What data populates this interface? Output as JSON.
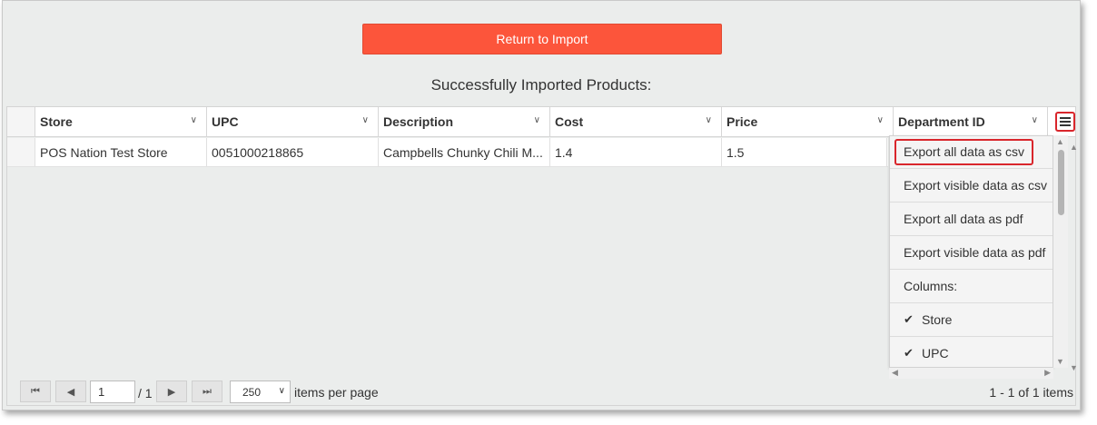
{
  "return_button": {
    "label": "Return to Import"
  },
  "page_title": "Successfully Imported Products:",
  "grid": {
    "columns": [
      {
        "label": "Store"
      },
      {
        "label": "UPC"
      },
      {
        "label": "Description"
      },
      {
        "label": "Cost"
      },
      {
        "label": "Price"
      },
      {
        "label": "Department ID"
      }
    ],
    "rows": [
      {
        "store": "POS Nation Test Store",
        "upc": "0051000218865",
        "description": "Campbells Chunky Chili M...",
        "cost": "1.4",
        "price": "1.5"
      }
    ]
  },
  "column_menu": {
    "items": [
      "Export all data as csv",
      "Export visible data as csv",
      "Export all data as pdf",
      "Export visible data as pdf",
      "Columns:"
    ],
    "column_toggles": [
      {
        "label": "Store",
        "checked": true
      },
      {
        "label": "UPC",
        "checked": true
      }
    ]
  },
  "pager": {
    "current_page": "1",
    "total_pages": "/ 1",
    "page_size": "250",
    "items_per_page_label": "items per page",
    "items_count": "1 - 1 of 1 items"
  },
  "colors": {
    "primary_button": "#fc553b",
    "highlight": "#d9262c",
    "background": "#ebedec"
  }
}
